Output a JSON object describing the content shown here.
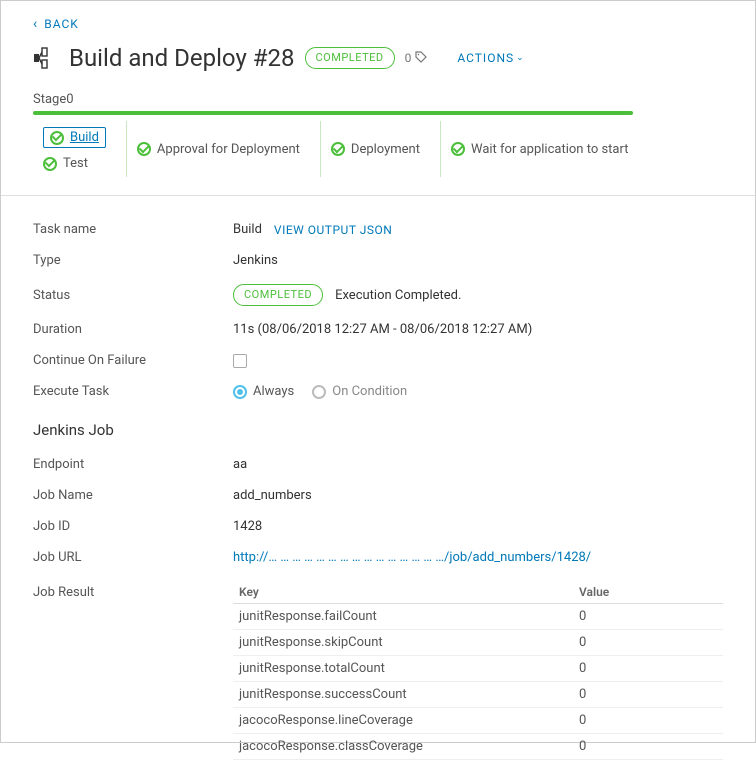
{
  "back_label": "BACK",
  "title": "Build and Deploy #28",
  "title_status": "COMPLETED",
  "tag_count": "0",
  "actions_label": "ACTIONS",
  "stage_label": "Stage0",
  "tasks": {
    "col0": {
      "build": "Build",
      "test": "Test"
    },
    "col1": "Approval for Deployment",
    "col2": "Deployment",
    "col3": "Wait for application to start"
  },
  "detail_labels": {
    "task_name": "Task name",
    "type": "Type",
    "status": "Status",
    "duration": "Duration",
    "continue_on_failure": "Continue On Failure",
    "execute_task": "Execute Task",
    "jenkins_job": "Jenkins Job",
    "endpoint": "Endpoint",
    "job_name": "Job Name",
    "job_id": "Job ID",
    "job_url": "Job URL",
    "job_result": "Job Result"
  },
  "detail_values": {
    "task_name": "Build",
    "view_output_json": "VIEW OUTPUT JSON",
    "type": "Jenkins",
    "status_pill": "COMPLETED",
    "status_text": "Execution Completed.",
    "duration": "11s (08/06/2018 12:27 AM - 08/06/2018 12:27 AM)",
    "exec_always": "Always",
    "exec_on_condition": "On Condition",
    "endpoint": "aa",
    "job_name": "add_numbers",
    "job_id": "1428",
    "job_url": "http://… … … … … … … … … … … … … … …/job/add_numbers/1428/"
  },
  "result_table": {
    "head_key": "Key",
    "head_value": "Value",
    "rows": [
      {
        "k": "junitResponse.failCount",
        "v": "0"
      },
      {
        "k": "junitResponse.skipCount",
        "v": "0"
      },
      {
        "k": "junitResponse.totalCount",
        "v": "0"
      },
      {
        "k": "junitResponse.successCount",
        "v": "0"
      },
      {
        "k": "jacocoResponse.lineCoverage",
        "v": "0"
      },
      {
        "k": "jacocoResponse.classCoverage",
        "v": "0"
      }
    ]
  }
}
